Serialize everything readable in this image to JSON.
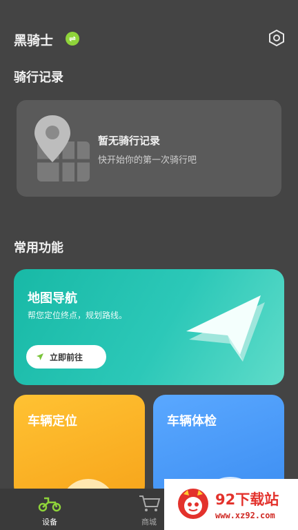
{
  "header": {
    "brand": "黑骑士",
    "badge_icon": "swap-badge-icon",
    "settings_icon": "hexagon-settings-icon"
  },
  "ride_records": {
    "section_title": "骑行记录",
    "empty_title": "暂无骑行记录",
    "empty_subtitle": "快开始你的第一次骑行吧",
    "illustration_icon": "map-pin-illustration"
  },
  "functions": {
    "section_title": "常用功能",
    "navigation": {
      "title": "地图导航",
      "subtitle": "帮您定位终点，规划路线。",
      "button_label": "立即前往",
      "color": "#22c1af"
    },
    "vehicle_location": {
      "title": "车辆定位",
      "color": "#f9b024"
    },
    "vehicle_check": {
      "title": "车辆体检",
      "color": "#4a9af8"
    }
  },
  "tabbar": {
    "items": [
      {
        "label": "设备",
        "icon": "scooter-icon",
        "active": true
      },
      {
        "label": "商城",
        "icon": "cart-icon",
        "active": false
      }
    ]
  },
  "watermark": {
    "name": "92下载站",
    "url": "www.xz92.com"
  },
  "colors": {
    "background": "#444444",
    "card": "#5a5a5a",
    "accent_green": "#8fd43a"
  }
}
